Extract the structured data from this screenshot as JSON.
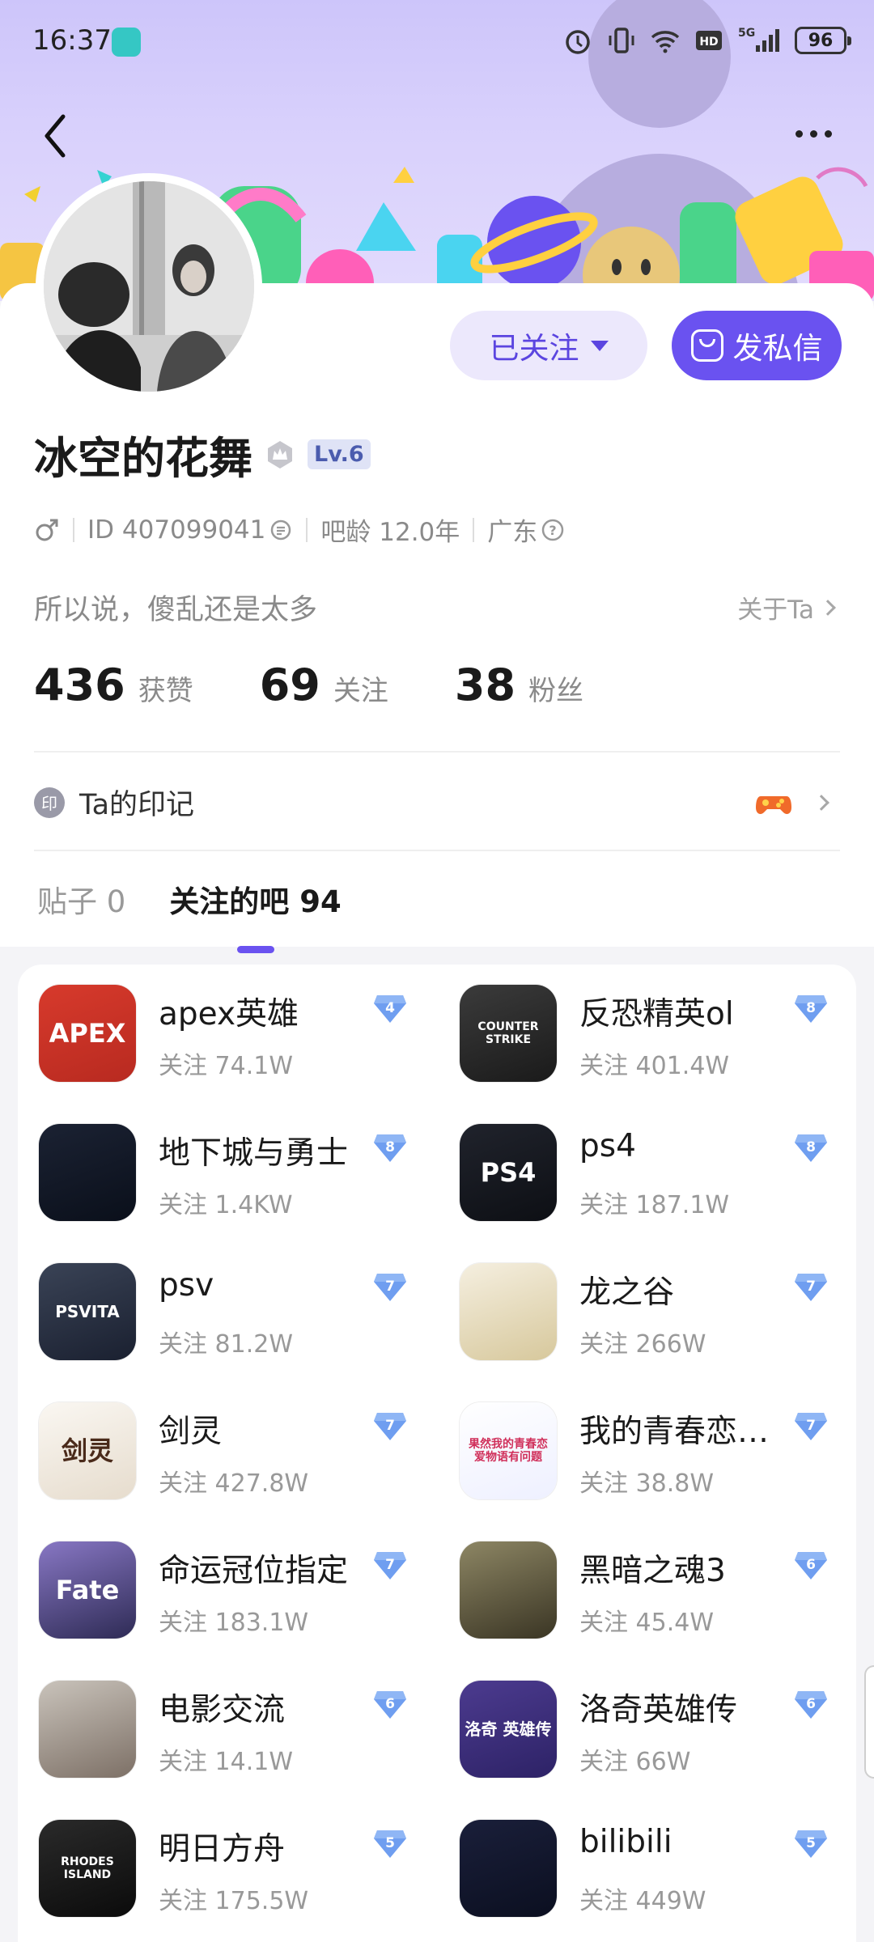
{
  "status_bar": {
    "time": "16:37",
    "battery": "96"
  },
  "header": {
    "back_icon": "chevron-left-icon",
    "more_icon": "ellipsis-icon"
  },
  "profile": {
    "username": "冰空的花舞",
    "level": "Lv.6",
    "follow_button": "已关注",
    "message_button": "发私信",
    "id_text": "ID 407099041",
    "forum_age": "吧龄 12.0年",
    "region": "广东",
    "bio": "所以说，傻乱还是太多",
    "about_link": "关于Ta",
    "stats": [
      {
        "value": "436",
        "label": "获赞"
      },
      {
        "value": "69",
        "label": "关注"
      },
      {
        "value": "38",
        "label": "粉丝"
      }
    ],
    "seal_icon_text": "印",
    "seal_label": "Ta的印记"
  },
  "tabs": [
    {
      "label": "贴子 0",
      "active": false
    },
    {
      "label": "关注的吧 94",
      "active": true
    }
  ],
  "forums": [
    {
      "name": "apex英雄",
      "follow": "关注 74.1W",
      "level": "4",
      "logo_text": "APEX"
    },
    {
      "name": "反恐精英ol",
      "follow": "关注 401.4W",
      "level": "8",
      "logo_text": "COUNTER STRIKE"
    },
    {
      "name": "地下城与勇士",
      "follow": "关注 1.4KW",
      "level": "8",
      "logo_text": ""
    },
    {
      "name": "ps4",
      "follow": "关注 187.1W",
      "level": "8",
      "logo_text": "PS4"
    },
    {
      "name": "psv",
      "follow": "关注 81.2W",
      "level": "7",
      "logo_text": "PSVITA"
    },
    {
      "name": "龙之谷",
      "follow": "关注 266W",
      "level": "7",
      "logo_text": ""
    },
    {
      "name": "剑灵",
      "follow": "关注 427.8W",
      "level": "7",
      "logo_text": "剑灵"
    },
    {
      "name": "我的青春恋…",
      "follow": "关注 38.8W",
      "level": "7",
      "logo_text": "果然我的青春恋爱物语有问题"
    },
    {
      "name": "命运冠位指定",
      "follow": "关注 183.1W",
      "level": "7",
      "logo_text": "Fate"
    },
    {
      "name": "黑暗之魂3",
      "follow": "关注 45.4W",
      "level": "6",
      "logo_text": ""
    },
    {
      "name": "电影交流",
      "follow": "关注 14.1W",
      "level": "6",
      "logo_text": ""
    },
    {
      "name": "洛奇英雄传",
      "follow": "关注 66W",
      "level": "6",
      "logo_text": "洛奇 英雄传"
    },
    {
      "name": "明日方舟",
      "follow": "关注 175.5W",
      "level": "5",
      "logo_text": "RHODES ISLAND"
    },
    {
      "name": "bilibili",
      "follow": "关注 449W",
      "level": "5",
      "logo_text": ""
    }
  ],
  "colors": {
    "accent": "#6a52f0",
    "follow_bg": "#ece8fc",
    "level_badge": "#6f9ef0"
  }
}
